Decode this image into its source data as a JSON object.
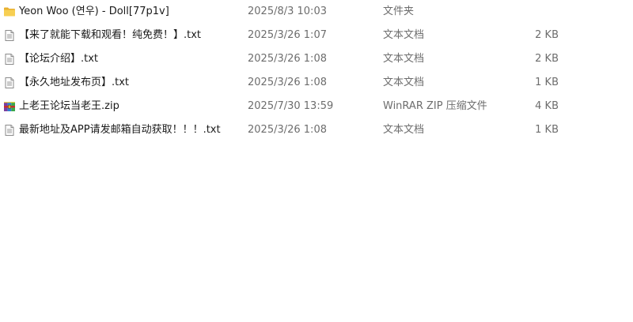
{
  "files": [
    {
      "name": "Yeon Woo (연우) - Doll[77p1v]",
      "date": "2025/8/3 10:03",
      "type": "文件夹",
      "size": "",
      "icon": "folder-icon"
    },
    {
      "name": "【来了就能下载和观看！纯免费！】.txt",
      "date": "2025/3/26 1:07",
      "type": "文本文档",
      "size": "2 KB",
      "icon": "text-file-icon"
    },
    {
      "name": "【论坛介绍】.txt",
      "date": "2025/3/26 1:08",
      "type": "文本文档",
      "size": "2 KB",
      "icon": "text-file-icon"
    },
    {
      "name": "【永久地址发布页】.txt",
      "date": "2025/3/26 1:08",
      "type": "文本文档",
      "size": "1 KB",
      "icon": "text-file-icon"
    },
    {
      "name": "上老王论坛当老王.zip",
      "date": "2025/7/30 13:59",
      "type": "WinRAR ZIP 压缩文件",
      "size": "4 KB",
      "icon": "winrar-archive-icon"
    },
    {
      "name": "最新地址及APP请发邮箱自动获取！！！.txt",
      "date": "2025/3/26 1:08",
      "type": "文本文档",
      "size": "1 KB",
      "icon": "text-file-icon"
    }
  ],
  "colors": {
    "folder": "#f4c542",
    "text_primary": "#1a1a1a",
    "text_secondary": "#6d6d6d"
  }
}
